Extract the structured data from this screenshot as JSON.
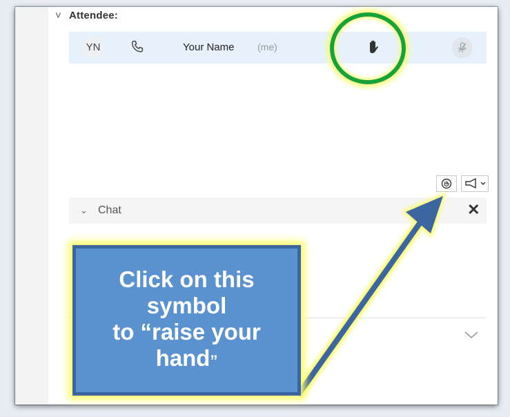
{
  "attendees": {
    "header_label": "Attendee:",
    "row": {
      "initials": "YN",
      "name": "Your Name",
      "me_tag": "(me)",
      "phone_icon": "phone-icon",
      "hand_icon": "raised-hand-icon",
      "mic_icon": "mic-muted-icon"
    }
  },
  "toolbar": {
    "raise_hand_icon": "raise-hand-icon",
    "reaction_icon": "megaphone-icon"
  },
  "chat": {
    "label": "Chat",
    "close_symbol": "✕",
    "expand_icon": "chevron-down-icon"
  },
  "callout": {
    "line1": "Click on this",
    "line2": "symbol",
    "line3": "to “raise your",
    "line4": "hand",
    "line4_end": "”"
  },
  "colors": {
    "highlight_circle": "#17a23a",
    "glow": "#fbfb6e",
    "callout_fill": "#5a92cf",
    "callout_border": "#3b66a0",
    "row_highlight": "#e6f1fb"
  }
}
